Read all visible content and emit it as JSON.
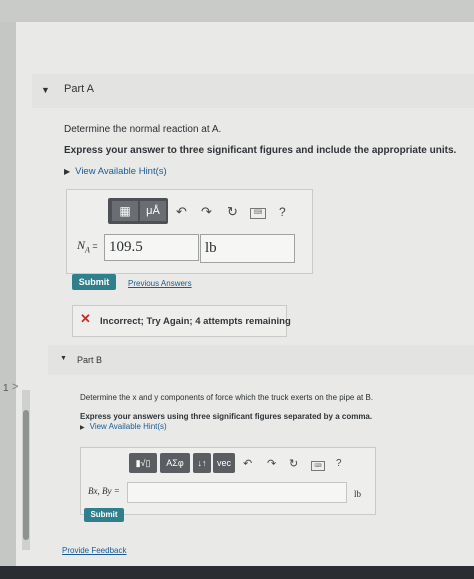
{
  "partA": {
    "title": "Part A",
    "prompt": "Determine the normal reaction at A.",
    "instruction": "Express your answer to three significant figures and include the appropriate units.",
    "hint_link": "View Available Hint(s)",
    "toolbar": {
      "template_icon": "▦",
      "units_label": "μÅ",
      "undo_icon": "↶",
      "redo_icon": "↷",
      "reset_icon": "↻",
      "keyboard_icon": "⌨",
      "help_icon": "?"
    },
    "answer_label": "N",
    "answer_label_sub": "A",
    "answer_label_eq": " =",
    "value": "109.5",
    "unit": "lb",
    "submit_label": "Submit",
    "previous_answers_label": "Previous Answers",
    "feedback": "Incorrect; Try Again; 4 attempts remaining"
  },
  "partB": {
    "title": "Part B",
    "prompt": "Determine the x and y components of force which the truck exerts on the pipe at B.",
    "instruction": "Express your answers using three significant figures separated by a comma.",
    "hint_link": "View Available Hint(s)",
    "toolbar": {
      "template_label": "▮√▯",
      "greek_label": "ΑΣφ",
      "arrows_label": "↓↑",
      "vec_label": "vec",
      "undo_icon": "↶",
      "redo_icon": "↷",
      "reset_icon": "↻",
      "keyboard_icon": "⌨",
      "help_icon": "?"
    },
    "answer_label": "Bx, By =",
    "unit": "lb",
    "submit_label": "Submit"
  },
  "provide_feedback": "Provide Feedback",
  "sidebar": {
    "item_number": "1",
    "arrow": ">"
  }
}
